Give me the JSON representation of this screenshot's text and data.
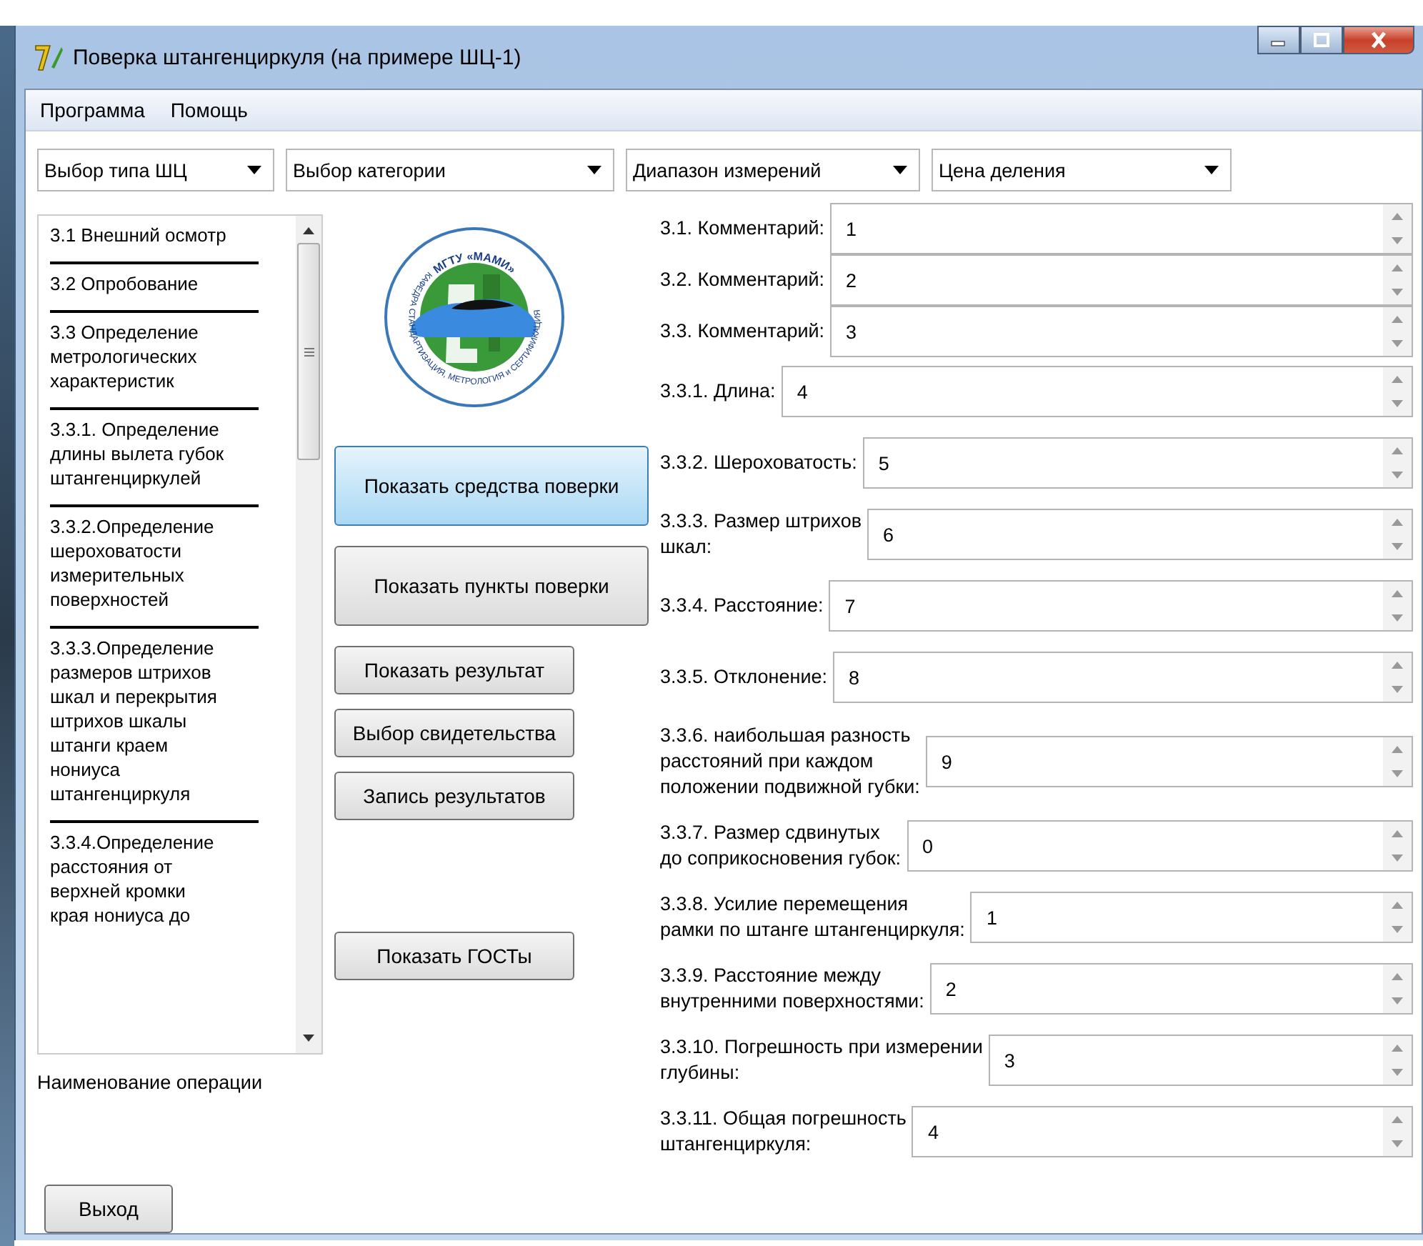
{
  "window": {
    "title": "Поверка штангенциркуля (на примере ШЦ-1)"
  },
  "menu": [
    "Программа",
    "Помощь"
  ],
  "dropdowns": [
    {
      "label": "Выбор типа ШЦ"
    },
    {
      "label": "Выбор категории"
    },
    {
      "label": "Диапазон измерений"
    },
    {
      "label": "Цена деления"
    }
  ],
  "operations_list": {
    "items": [
      "3.1 Внешний осмотр",
      "3.2 Опробование",
      "3.3 Определение\nметрологических\nхарактеристик",
      "3.3.1. Определение\nдлины вылета губок\nштангенциркулей",
      "3.3.2.Определение\n шероховатости\nизмерительных\nповерхностей",
      "3.3.3.Определение\nразмеров штрихов\nшкал и перекрытия\nштрихов шкалы\nштанги краем\nнониуса\nштангенциркуля",
      "3.3.4.Определение\nрасстояния от\nверхней кромки\nкрая нониуса до"
    ]
  },
  "operation_caption": "Наименование операции",
  "logo": {
    "top_text": "МГТУ «МАМИ»",
    "ring_text": "КАФЕДРА СТАНДАРТИЗАЦИЯ, МЕТРОЛОГИЯ и СЕРТИФИКАЦИЯ"
  },
  "buttons": [
    {
      "label": "Показать средства поверки",
      "kind": "large",
      "focused": true
    },
    {
      "label": "Показать пункты поверки",
      "kind": "large",
      "focused": false
    },
    {
      "label": "Показать результат",
      "kind": "small",
      "focused": false
    },
    {
      "label": "Выбор свидетельства",
      "kind": "small",
      "focused": false
    },
    {
      "label": "Запись результатов",
      "kind": "small",
      "focused": false
    },
    {
      "label": "Показать ГОСТы",
      "kind": "small",
      "focused": false
    }
  ],
  "exit_button": "Выход",
  "comment_fields": [
    {
      "label": "3.1. Комментарий:",
      "value": "1"
    },
    {
      "label": "3.2. Комментарий:",
      "value": "2"
    },
    {
      "label": "3.3. Комментарий:",
      "value": "3"
    }
  ],
  "measurement_fields": [
    {
      "label": "3.3.1. Длина:",
      "value": "4"
    },
    {
      "label": "3.3.2. Шероховатость:",
      "value": "5"
    },
    {
      "label": "3.3.3. Размер штрихов\nшкал:",
      "value": "6"
    },
    {
      "label": "3.3.4. Расстояние:",
      "value": "7"
    },
    {
      "label": "3.3.5. Отклонение:",
      "value": "8"
    },
    {
      "label": "3.3.6. наибольшая разность\n расстояний при каждом\n положении подвижной губки:",
      "value": "9"
    },
    {
      "label": "3.3.7. Размер сдвинутых\nдо соприкосновения губок:",
      "value": "0"
    },
    {
      "label": "3.3.8. Усилие перемещения\nрамки по штанге штангенциркуля:",
      "value": "1"
    },
    {
      "label": "3.3.9. Расcтояние между\nвнутренними поверхностями:",
      "value": "2"
    },
    {
      "label": "3.3.10. Погрешность при измерении\n глубины:",
      "value": "3"
    },
    {
      "label": "3.3.11. Общая погрешность\n штангенциркуля:",
      "value": "4"
    }
  ]
}
